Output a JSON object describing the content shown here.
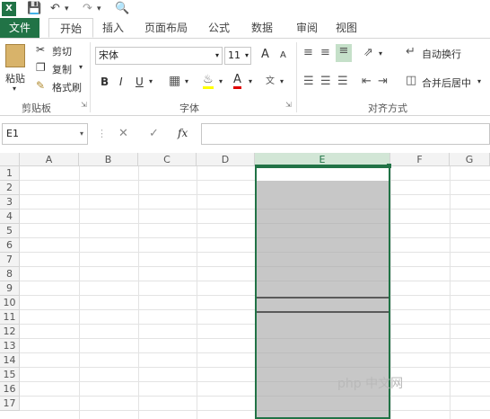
{
  "app": {
    "name": "Excel",
    "accent": "#217346"
  },
  "tabs": [
    "文件",
    "开始",
    "插入",
    "页面布局",
    "公式",
    "数据",
    "审阅",
    "视图"
  ],
  "active_tab": "开始",
  "clipboard": {
    "paste": "粘贴",
    "cut": "剪切",
    "copy": "复制",
    "format_painter": "格式刷",
    "label": "剪贴板"
  },
  "font": {
    "name": "宋体",
    "size": "11",
    "bold": "B",
    "italic": "I",
    "underline": "U",
    "grow": "A",
    "shrink": "A",
    "label": "字体"
  },
  "alignment": {
    "wrap": "自动换行",
    "merge": "合并后居中",
    "label": "对齐方式"
  },
  "formula_bar": {
    "name_box": "E1",
    "fx": "fx",
    "value": ""
  },
  "columns": [
    "A",
    "B",
    "C",
    "D",
    "E",
    "F",
    "G"
  ],
  "rows": [
    "1",
    "2",
    "3",
    "4",
    "5",
    "6",
    "7",
    "8",
    "9",
    "10",
    "11",
    "12",
    "13",
    "14",
    "15",
    "16",
    "17"
  ],
  "selected_column": "E",
  "watermark": "php 中文网"
}
